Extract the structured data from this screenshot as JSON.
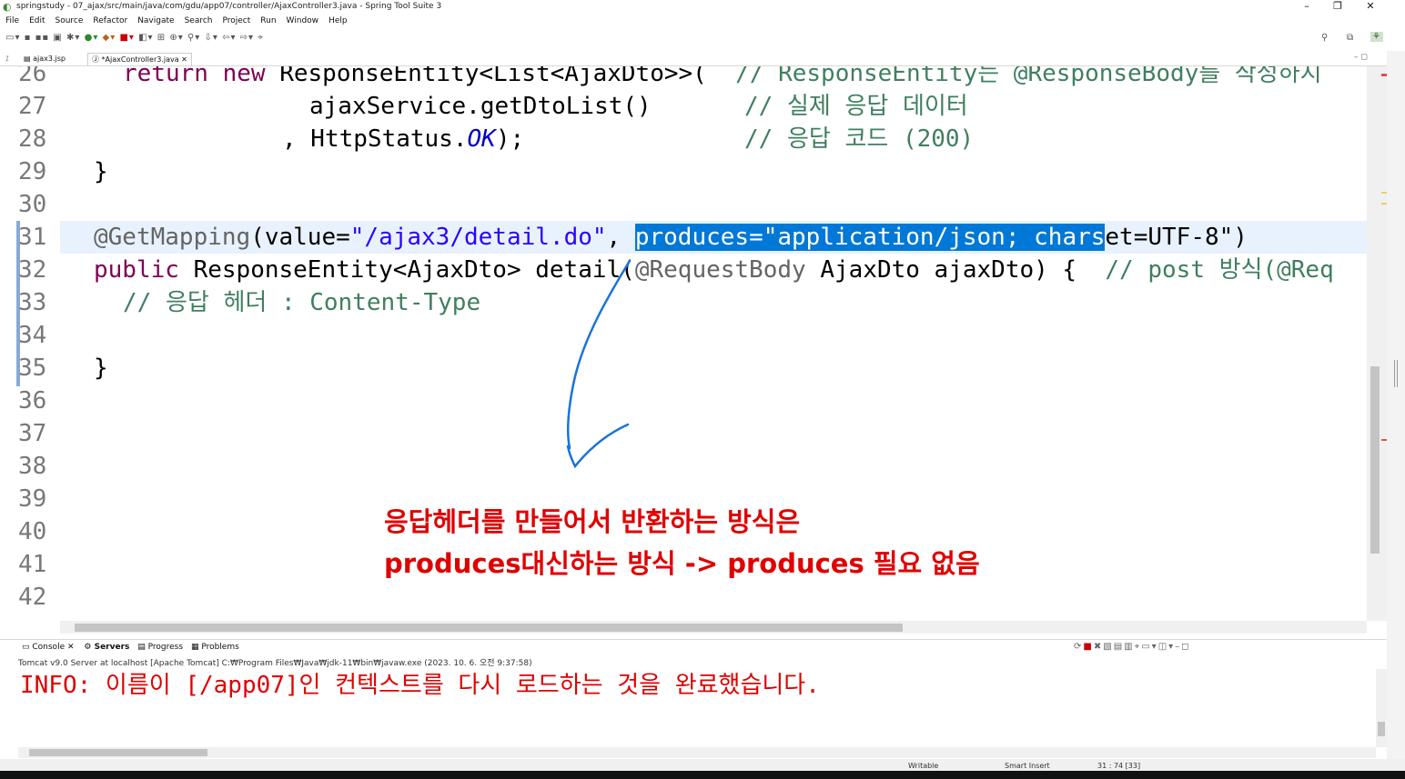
{
  "window": {
    "title": "springstudy - 07_ajax/src/main/java/com/gdu/app07/controller/AjaxController3.java - Spring Tool Suite 3",
    "minimize": "–",
    "restore": "❐",
    "close": "✕"
  },
  "menu": [
    "File",
    "Edit",
    "Source",
    "Refactor",
    "Navigate",
    "Search",
    "Project",
    "Run",
    "Window",
    "Help"
  ],
  "tabs": [
    {
      "label": "ajax3.jsp"
    },
    {
      "label": "*AjaxController3.java"
    }
  ],
  "editor": {
    "line_numbers": [
      "26",
      "27",
      "28",
      "29",
      "30",
      "31",
      "32",
      "33",
      "34",
      "35",
      "36",
      "37",
      "38",
      "39",
      "40",
      "41",
      "42"
    ],
    "line26": {
      "kw1": "return",
      "kw2": "new",
      "text": "ResponseEntity<List<AjaxDto>>(",
      "comment": "// ResponseEntity는 @ResponseBody를 작성하지"
    },
    "line27": {
      "text": "ajaxService.getDtoList()",
      "comment": "// 실제 응답 데이터"
    },
    "line28": {
      "text1": ", HttpStatus.",
      "field": "OK",
      "text2": ");",
      "comment": "// 응답 코드 (200)"
    },
    "line29": "}",
    "line31": {
      "annotation": "@GetMapping",
      "p1": "(value=",
      "str1": "\"/ajax3/detail.do\"",
      "p2": ", ",
      "sel": "produces=\"application/json; chars",
      "rest": "et=UTF-8\")"
    },
    "line32": {
      "kw": "public",
      "t1": " ResponseEntity<AjaxDto> detail(",
      "annotation": "@RequestBody",
      "t2": " AjaxDto ajaxDto) {  ",
      "comment": "// post 방식(@Req"
    },
    "line33": {
      "comment": "// 응답 헤더 : Content-Type"
    },
    "line35": "}"
  },
  "annotation_note": {
    "line1": "응답헤더를 만들어서 반환하는 방식은",
    "line2": "produces대신하는 방식 -> produces 필요 없음"
  },
  "console_tabs": [
    {
      "label": "Console"
    },
    {
      "label": "Servers"
    },
    {
      "label": "Progress"
    },
    {
      "label": "Problems"
    }
  ],
  "console": {
    "description": "Tomcat v9.0 Server at localhost [Apache Tomcat] C:₩Program Files₩Java₩jdk-11₩bin₩javaw.exe  (2023. 10. 6. 오전 9:37:58)",
    "output": "INFO: 이름이 [/app07]인 컨텍스트를 다시 로드하는 것을 완료했습니다."
  },
  "status": {
    "writable": "Writable",
    "insert": "Smart Insert",
    "position": "31 : 74 [33]"
  },
  "colors": {
    "selection": "#0078d7",
    "keyword": "#7f0055",
    "comment": "#3f7f5f",
    "note": "#e00000"
  }
}
